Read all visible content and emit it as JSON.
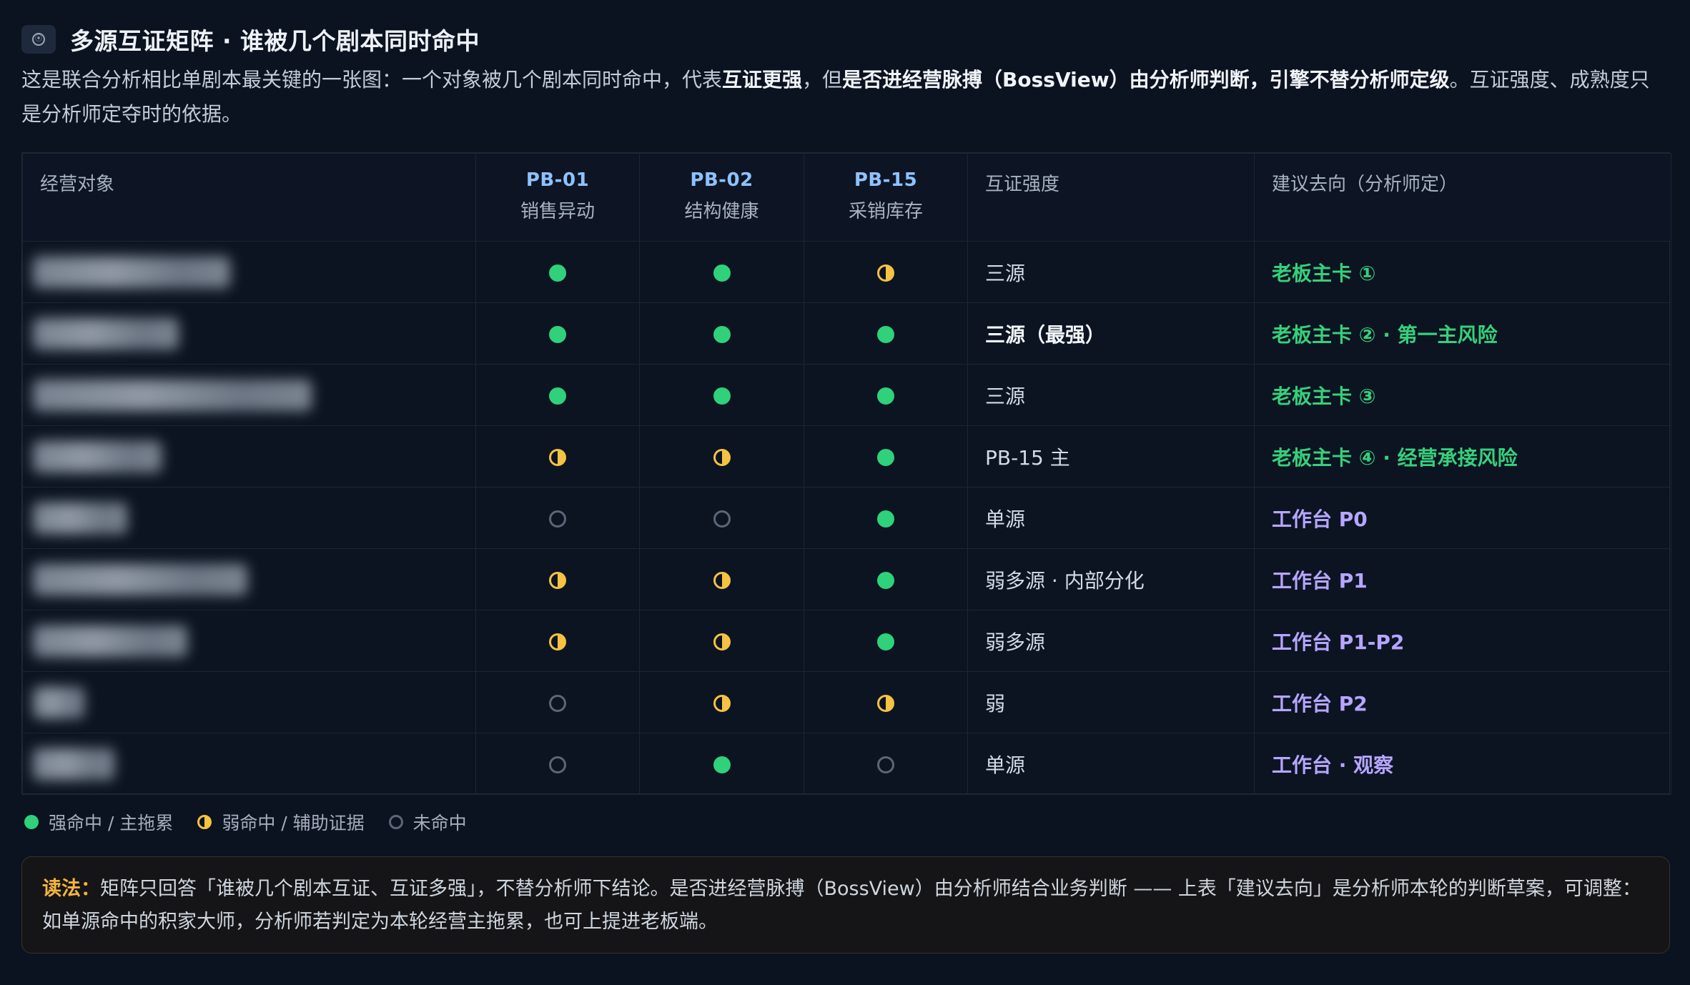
{
  "header": {
    "title": "多源互证矩阵 · 谁被几个剧本同时命中",
    "icon": "info-badge-icon",
    "intro_segments": [
      {
        "text": "这是联合分析相比单剧本最关键的一张图：一个对象被几个剧本同时命中，代表",
        "bold": false
      },
      {
        "text": "互证更强",
        "bold": true
      },
      {
        "text": "，但",
        "bold": false
      },
      {
        "text": "是否进经营脉搏（BossView）由分析师判断，引擎不替分析师定级",
        "bold": true
      },
      {
        "text": "。互证强度、成熟度只是分析师定夺时的依据。",
        "bold": false
      }
    ]
  },
  "table": {
    "headers": {
      "object": "经营对象",
      "pb01_code": "PB-01",
      "pb01_desc": "销售异动",
      "pb02_code": "PB-02",
      "pb02_desc": "结构健康",
      "pb15_code": "PB-15",
      "pb15_desc": "采销库存",
      "strength": "互证强度",
      "recommendation": "建议去向（分析师定）"
    },
    "rows": [
      {
        "object_blur_fraction": 0.46,
        "pb01": "full",
        "pb02": "full",
        "pb15": "half",
        "strength": "三源",
        "strength_bold": false,
        "rec": "老板主卡 ①",
        "rec_color": "green"
      },
      {
        "object_blur_fraction": 0.34,
        "pb01": "full",
        "pb02": "full",
        "pb15": "full",
        "strength": "三源（最强）",
        "strength_bold": true,
        "rec": "老板主卡 ② · 第一主风险",
        "rec_color": "green"
      },
      {
        "object_blur_fraction": 0.65,
        "pb01": "full",
        "pb02": "full",
        "pb15": "full",
        "strength": "三源",
        "strength_bold": false,
        "rec": "老板主卡 ③",
        "rec_color": "green"
      },
      {
        "object_blur_fraction": 0.3,
        "pb01": "half",
        "pb02": "half",
        "pb15": "full",
        "strength": "PB-15 主",
        "strength_bold": false,
        "rec": "老板主卡 ④ · 经营承接风险",
        "rec_color": "green"
      },
      {
        "object_blur_fraction": 0.22,
        "pb01": "none",
        "pb02": "none",
        "pb15": "full",
        "strength": "单源",
        "strength_bold": false,
        "rec": "工作台 P0",
        "rec_color": "purple"
      },
      {
        "object_blur_fraction": 0.5,
        "pb01": "half",
        "pb02": "half",
        "pb15": "full",
        "strength": "弱多源 · 内部分化",
        "strength_bold": false,
        "rec": "工作台 P1",
        "rec_color": "purple"
      },
      {
        "object_blur_fraction": 0.36,
        "pb01": "half",
        "pb02": "half",
        "pb15": "full",
        "strength": "弱多源",
        "strength_bold": false,
        "rec": "工作台 P1-P2",
        "rec_color": "purple"
      },
      {
        "object_blur_fraction": 0.12,
        "pb01": "none",
        "pb02": "half",
        "pb15": "half",
        "strength": "弱",
        "strength_bold": false,
        "rec": "工作台 P2",
        "rec_color": "purple"
      },
      {
        "object_blur_fraction": 0.19,
        "pb01": "none",
        "pb02": "full",
        "pb15": "none",
        "strength": "单源",
        "strength_bold": false,
        "rec": "工作台 · 观察",
        "rec_color": "purple"
      }
    ]
  },
  "legend": {
    "full": "强命中 / 主拖累",
    "half": "弱命中 / 辅助证据",
    "none": "未命中"
  },
  "note": {
    "lead": "读法：",
    "body": "矩阵只回答「谁被几个剧本互证、互证多强」，不替分析师下结论。是否进经营脉搏（BossView）由分析师结合业务判断 —— 上表「建议去向」是分析师本轮的判断草案，可调整：如单源命中的积家大师，分析师若判定为本轮经营主拖累，也可上提进老板端。"
  },
  "colors": {
    "background": "#0b1220",
    "strong_hit": "#2fd17a",
    "weak_hit": "#f5c242",
    "miss": "#5b6778",
    "pb_code": "#8ec2ff",
    "rec_green": "#36d07b",
    "rec_purple": "#b6a6ff",
    "note_lead": "#f4b43e"
  }
}
